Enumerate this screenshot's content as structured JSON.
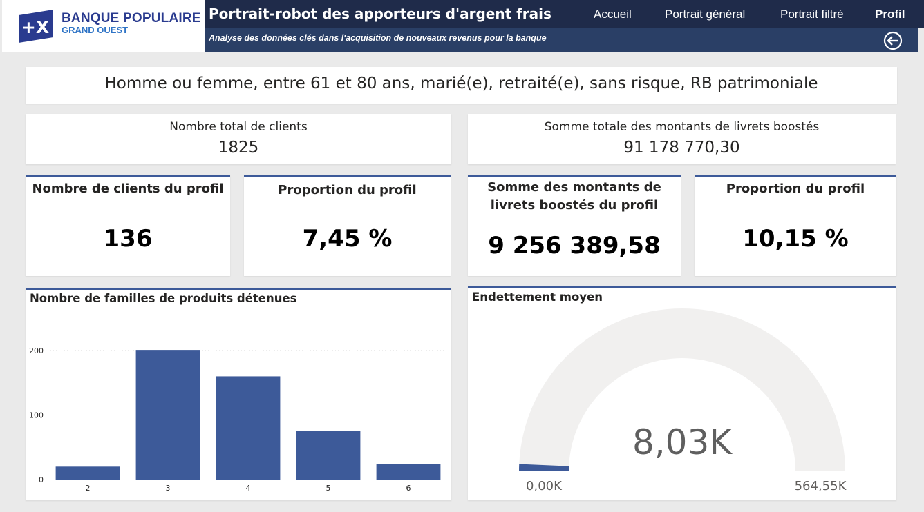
{
  "header": {
    "logo_line1": "BANQUE POPULAIRE",
    "logo_line2": "GRAND OUEST",
    "logo_mark": "+X",
    "title": "Portrait-robot des apporteurs d'argent frais",
    "subtitle": "Analyse des données clés dans l'acquisition de nouveaux revenus pour la banque",
    "nav": [
      {
        "label": "Accueil",
        "active": false
      },
      {
        "label": "Portrait général",
        "active": false
      },
      {
        "label": "Portrait filtré",
        "active": false
      },
      {
        "label": "Profil",
        "active": true
      }
    ],
    "back_icon": "circle-arrow-left-icon"
  },
  "profile_description": "Homme ou femme, entre 61 et 80 ans, marié(e), retraité(e), sans risque, RB patrimoniale",
  "kpis": {
    "total_clients": {
      "label": "Nombre total de clients",
      "value": "1825"
    },
    "total_amount": {
      "label": "Somme totale des montants de livrets boostés",
      "value": "91 178 770,30"
    },
    "profile_clients": {
      "label": "Nombre de clients du profil",
      "value": "136"
    },
    "profile_clients_share": {
      "label": "Proportion du profil",
      "value": "7,45 %"
    },
    "profile_amount": {
      "label": "Somme des montants de livrets boostés du profil",
      "value": "9 256 389,58"
    },
    "profile_amount_share": {
      "label": "Proportion du profil",
      "value": "10,15 %"
    }
  },
  "colors": {
    "accent": "#3d5a99",
    "header_dark": "#1f2b4a",
    "header_sub": "#2a3f66",
    "gauge_track": "#f1f0ef"
  },
  "chart_data": [
    {
      "type": "bar",
      "title": "Nombre de familles de produits détenues",
      "categories": [
        "2",
        "3",
        "4",
        "5",
        "6"
      ],
      "values": [
        20,
        201,
        160,
        75,
        24
      ],
      "ylim": [
        0,
        230
      ],
      "yticks": [
        0,
        100,
        200
      ],
      "grid": true
    },
    {
      "type": "gauge",
      "title": "Endettement moyen",
      "value": 8030,
      "value_label": "8,03K",
      "min": 0,
      "min_label": "0,00K",
      "max": 564550,
      "max_label": "564,55K"
    }
  ]
}
